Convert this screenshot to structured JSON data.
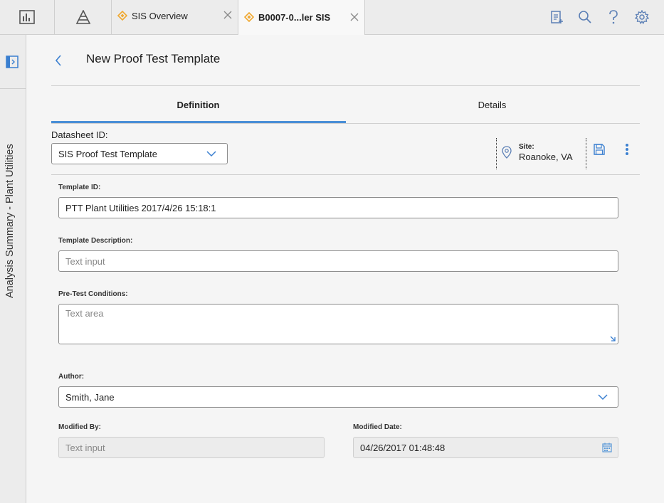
{
  "topbar": {
    "icons": [
      "dashboard-icon",
      "hierarchy-icon"
    ],
    "tabs": [
      {
        "label": "SIS Overview",
        "icon": "sis-diamond-icon",
        "active": false
      },
      {
        "label": "B0007-0...ler SIS",
        "icon": "sis-diamond-icon",
        "active": true
      }
    ],
    "right_icons": [
      "clipboard-add-icon",
      "search-icon",
      "help-icon",
      "gear-icon"
    ]
  },
  "leftrail": {
    "title": "Analysis Summary - Plant Utilities",
    "toggle_icon": "panel-expand-icon"
  },
  "page": {
    "title": "New Proof Test Template",
    "back_icon": "chevron-left-icon"
  },
  "tabs": [
    "Definition",
    "Details"
  ],
  "datasheet": {
    "label": "Datasheet ID:",
    "value": "SIS Proof Test Template"
  },
  "site": {
    "label": "Site:",
    "value": "Roanoke, VA"
  },
  "form": {
    "template_id": {
      "label": "Template ID:",
      "value": "PTT Plant Utilities 2017/4/26 15:18:1"
    },
    "template_description": {
      "label": "Template Description:",
      "placeholder": "Text input"
    },
    "pre_test_conditions": {
      "label": "Pre-Test Conditions:",
      "placeholder": "Text area"
    },
    "author": {
      "label": "Author:",
      "value": "Smith, Jane"
    },
    "modified_by": {
      "label": "Modified By:",
      "placeholder": "Text input"
    },
    "modified_date": {
      "label": "Modified Date:",
      "value": "04/26/2017 01:48:48"
    }
  },
  "colors": {
    "accent": "#4a8fd6",
    "icon_blue": "#3a7fd0",
    "tab_diamond": "#f0a830"
  }
}
